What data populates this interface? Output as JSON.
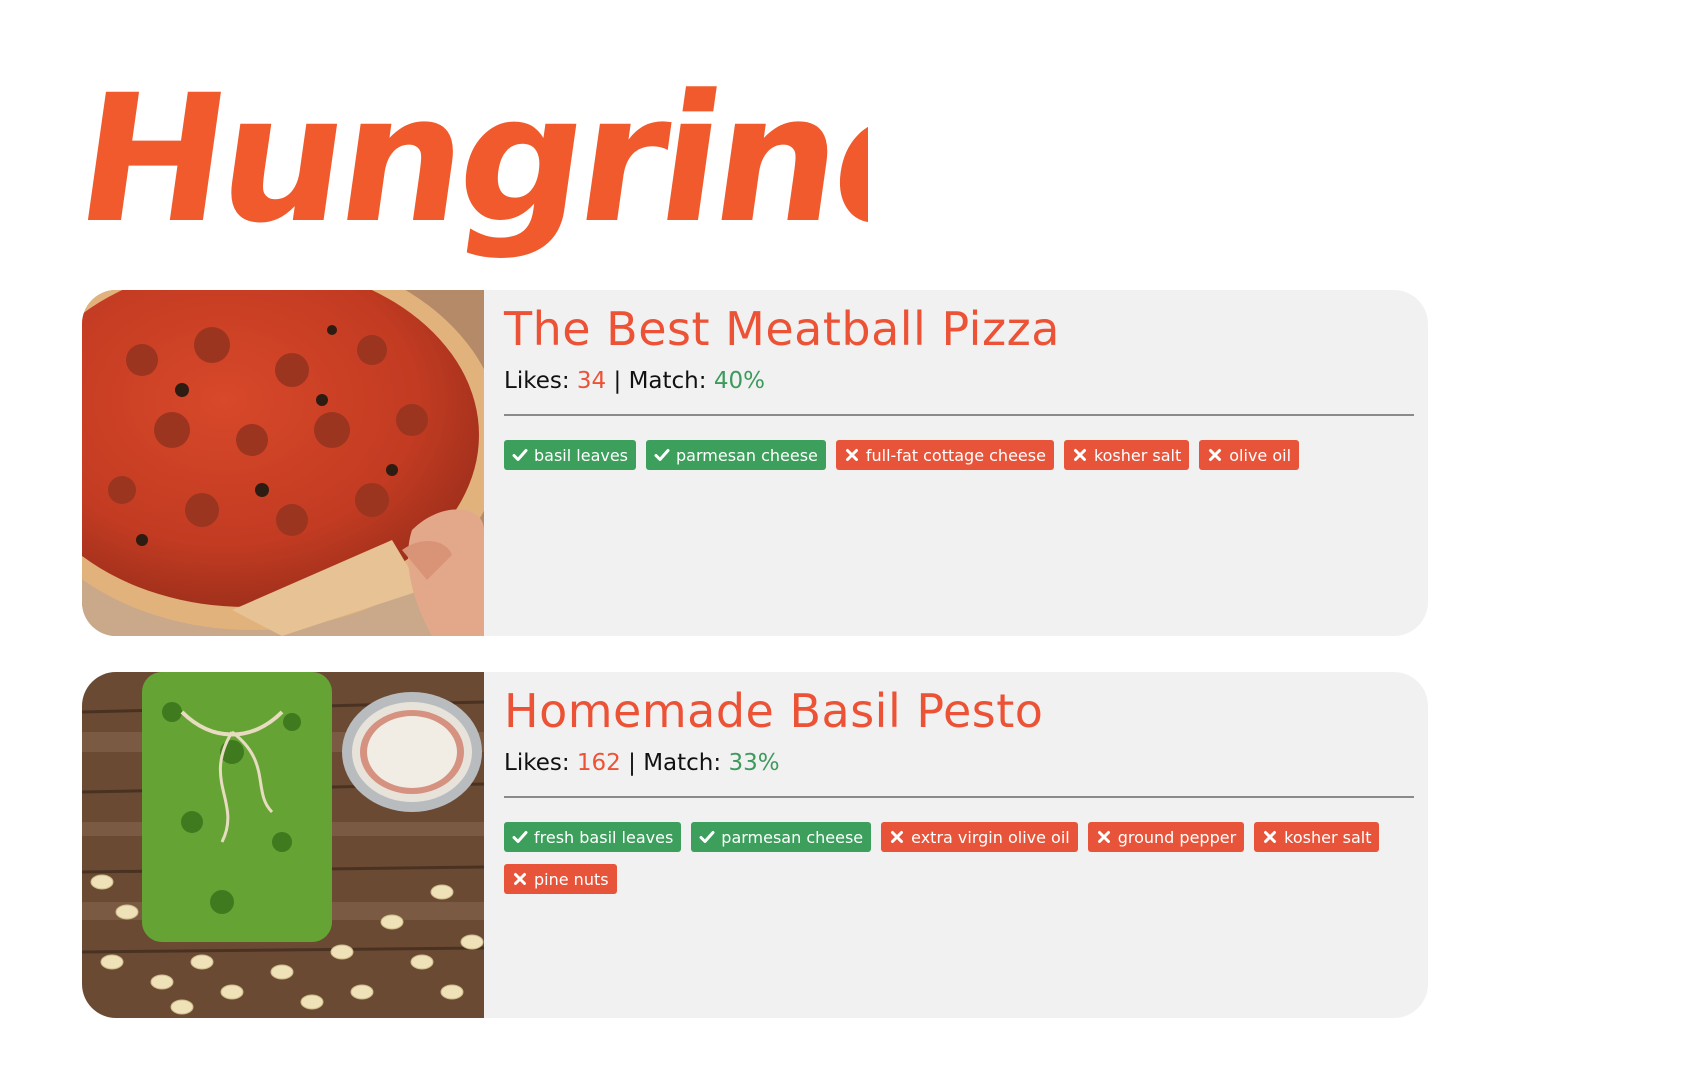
{
  "brand": {
    "logo_text": "Hungrindr",
    "logo_color": "#f05a2c"
  },
  "colors": {
    "accent": "#ec5336",
    "match": "#3c9a5c",
    "have_tag": "#3c9f5c",
    "missing_tag": "#e8543a",
    "card_bg": "#f1f1f1"
  },
  "recipes": [
    {
      "title": "The Best Meatball Pizza",
      "likes_label": "Likes:",
      "likes": "34",
      "separator": "|",
      "match_label": "Match:",
      "match": "40%",
      "image_icon": "pizza-photo",
      "ingredients": [
        {
          "name": "basil leaves",
          "have": true,
          "icon": "check-icon"
        },
        {
          "name": "parmesan cheese",
          "have": true,
          "icon": "check-icon"
        },
        {
          "name": "full-fat cottage cheese",
          "have": false,
          "icon": "close-icon"
        },
        {
          "name": "kosher salt",
          "have": false,
          "icon": "close-icon"
        },
        {
          "name": "olive oil",
          "have": false,
          "icon": "close-icon"
        }
      ]
    },
    {
      "title": "Homemade Basil Pesto",
      "likes_label": "Likes:",
      "likes": "162",
      "separator": "|",
      "match_label": "Match:",
      "match": "33%",
      "image_icon": "pesto-photo",
      "ingredients": [
        {
          "name": "fresh basil leaves",
          "have": true,
          "icon": "check-icon"
        },
        {
          "name": "parmesan cheese",
          "have": true,
          "icon": "check-icon"
        },
        {
          "name": "extra virgin olive oil",
          "have": false,
          "icon": "close-icon"
        },
        {
          "name": "ground pepper",
          "have": false,
          "icon": "close-icon"
        },
        {
          "name": "kosher salt",
          "have": false,
          "icon": "close-icon"
        },
        {
          "name": "pine nuts",
          "have": false,
          "icon": "close-icon"
        }
      ]
    }
  ]
}
